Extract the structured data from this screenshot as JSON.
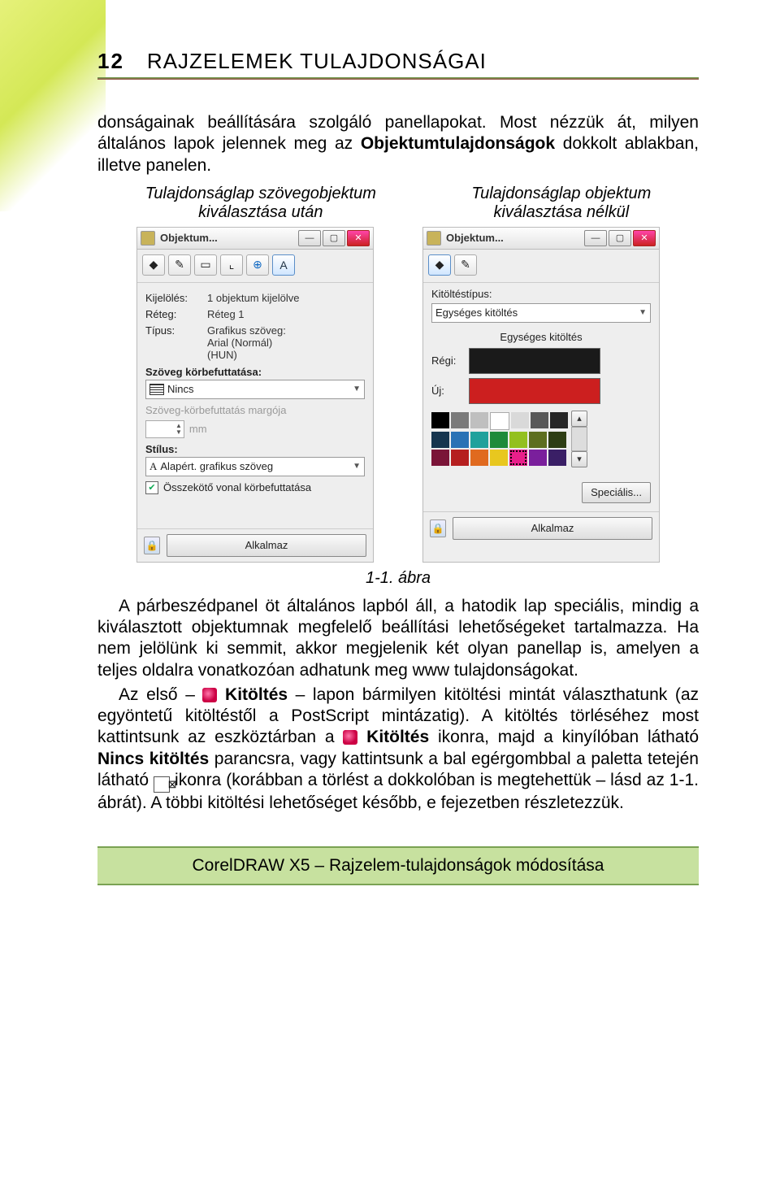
{
  "page_number": "12",
  "chapter_title": "RAJZELEMEK TULAJDONSÁGAI",
  "intro_line1": "donságainak beállítására szolgáló panellapokat. Most nézzük át, milyen általános lapok jelennek meg az ",
  "intro_bold": "Objektumtulajdonságok",
  "intro_line2": " dokkolt ablakban, illetve panelen.",
  "caption_left_l1": "Tulajdonságlap szövegobjektum",
  "caption_left_l2": "kiválasztása után",
  "caption_right_l1": "Tulajdonságlap objektum",
  "caption_right_l2": "kiválasztása nélkül",
  "docker": {
    "title": "Objektum...",
    "left": {
      "kijeloles_lbl": "Kijelölés:",
      "kijeloles_val": "1 objektum kijelölve",
      "reteg_lbl": "Réteg:",
      "reteg_val": "Réteg 1",
      "tipus_lbl": "Típus:",
      "tipus_val_l1": "Grafikus szöveg:",
      "tipus_val_l2": "Arial (Normál)",
      "tipus_val_l3": "(HUN)",
      "wrap_lbl": "Szöveg körbefuttatása:",
      "wrap_val": "Nincs",
      "margin_lbl": "Szöveg-körbefuttatás margója",
      "margin_unit": "mm",
      "style_lbl": "Stílus:",
      "style_val": "Alapért. grafikus szöveg",
      "connector": "Összekötő vonal körbefuttatása"
    },
    "right": {
      "filltype_lbl": "Kitöltéstípus:",
      "filltype_val": "Egységes kitöltés",
      "uniform_lbl": "Egységes kitöltés",
      "old_lbl": "Régi:",
      "new_lbl": "Új:",
      "special_btn": "Speciális..."
    },
    "apply": "Alkalmaz"
  },
  "figure_caption": "1-1. ábra",
  "para2": "A párbeszédpanel öt általános lapból áll, a hatodik lap speciális, mindig a kiválasztott objektumnak megfelelő beállítási lehetőségeket tartalmazza. Ha nem jelölünk ki semmit, akkor megjelenik két olyan panellap is, amelyen a teljes oldalra vonatkozóan adhatunk meg www tulajdonságokat.",
  "para3_a": "Az első – ",
  "para3_b_bold": "Kitöltés",
  "para3_c": " – lapon bármilyen kitöltési mintát választhatunk (az egyöntetű kitöltéstől a PostScript mintázatig). A kitöltés törléséhez most kattintsunk az eszköztárban a ",
  "para3_d_bold": "Kitöltés",
  "para3_e": " ikonra, majd a kinyílóban látható ",
  "para3_f_bold": "Nincs kitöltés",
  "para3_g": " parancsra, vagy kattintsunk a bal egérgombbal a paletta tetején látható ",
  "para3_h": " ikonra (korábban a törlést a dokkolóban is megtehettük – lásd az 1-1. ábrát). A többi kitöltési lehetőséget később, e fejezetben részletezzük.",
  "footer": "CorelDRAW X5 – Rajzelem-tulajdonságok módosítása"
}
